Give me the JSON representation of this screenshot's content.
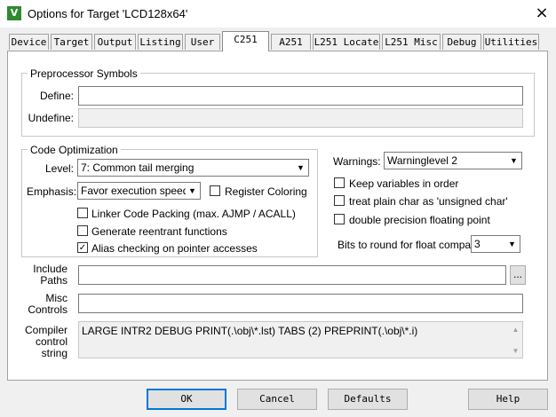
{
  "window": {
    "title": "Options for Target 'LCD128x64'",
    "close_icon": "×",
    "app_icon": "V"
  },
  "tabs": [
    {
      "label": "Device"
    },
    {
      "label": "Target"
    },
    {
      "label": "Output"
    },
    {
      "label": "Listing"
    },
    {
      "label": "User"
    },
    {
      "label": "C251"
    },
    {
      "label": "A251"
    },
    {
      "label": "L251 Locate"
    },
    {
      "label": "L251 Misc"
    },
    {
      "label": "Debug"
    },
    {
      "label": "Utilities"
    }
  ],
  "active_tab": "C251",
  "preprocessor": {
    "title": "Preprocessor Symbols",
    "define_label": "Define:",
    "define_value": "",
    "undefine_label": "Undefine:",
    "undefine_value": ""
  },
  "code_opt": {
    "title": "Code Optimization",
    "level_label": "Level:",
    "level_value": "7: Common tail merging",
    "emphasis_label": "Emphasis:",
    "emphasis_value": "Favor execution speed",
    "register_coloring": {
      "label": "Register Coloring",
      "checked": false
    },
    "linker_packing": {
      "label": "Linker Code Packing (max. AJMP / ACALL)",
      "checked": false
    },
    "reentrant": {
      "label": "Generate reentrant functions",
      "checked": false
    },
    "alias": {
      "label": "Alias checking on pointer accesses",
      "checked": true
    }
  },
  "right": {
    "warnings_label": "Warnings:",
    "warnings_value": "Warninglevel 2",
    "keep_vars": {
      "label": "Keep variables in order",
      "checked": false
    },
    "plain_char": {
      "label": "treat plain char as 'unsigned char'",
      "checked": false
    },
    "double_prec": {
      "label": "double precision floating point",
      "checked": false
    },
    "bits_label": "Bits to round for float compare:",
    "bits_value": "3"
  },
  "include": {
    "label_1": "Include",
    "label_2": "Paths",
    "value": "",
    "browse": "..."
  },
  "misc": {
    "label_1": "Misc",
    "label_2": "Controls",
    "value": ""
  },
  "compiler": {
    "label_1": "Compiler",
    "label_2": "control",
    "label_3": "string",
    "value": "LARGE INTR2 DEBUG PRINT(.\\obj\\*.lst) TABS (2) PREPRINT(.\\obj\\*.i)"
  },
  "buttons": {
    "ok": "OK",
    "cancel": "Cancel",
    "defaults": "Defaults",
    "help": "Help"
  },
  "check_glyph": "✓",
  "arrow_glyph": "▼"
}
